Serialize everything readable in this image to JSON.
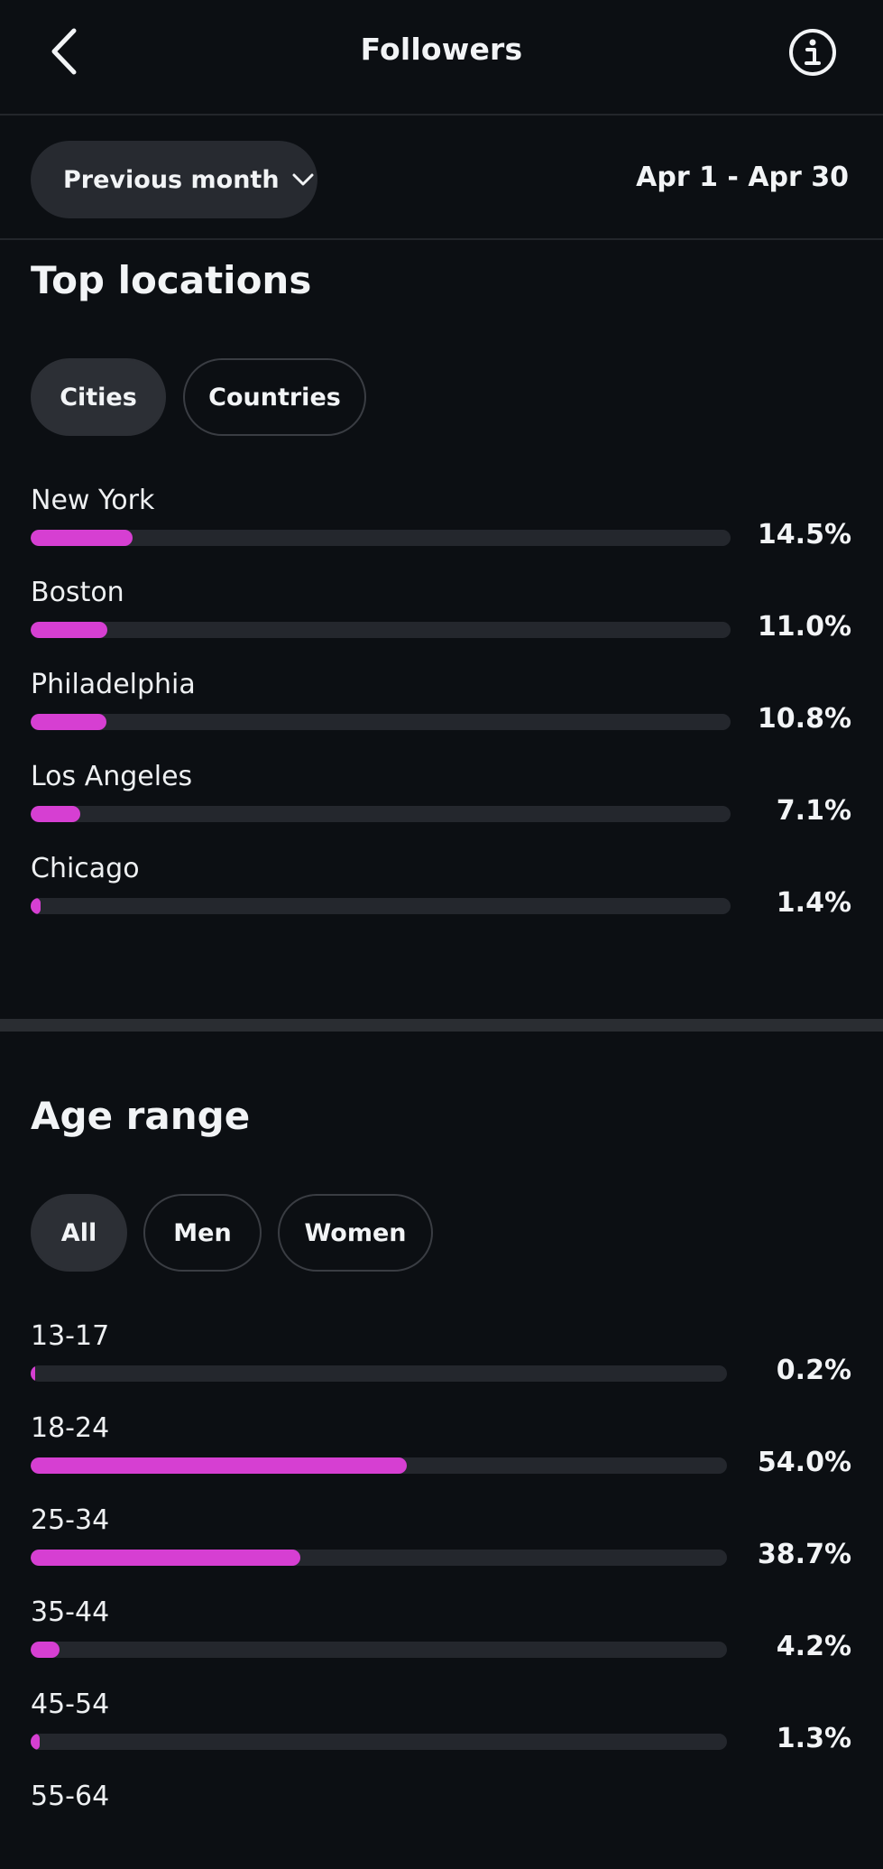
{
  "header": {
    "title": "Followers",
    "back_icon": "chevron-left-icon",
    "info_icon": "info-icon"
  },
  "filters": {
    "period": "Previous month",
    "date_range": "Apr 1 - Apr 30"
  },
  "top_locations": {
    "title": "Top locations",
    "tabs": [
      {
        "label": "Cities",
        "active": true
      },
      {
        "label": "Countries",
        "active": false
      }
    ],
    "items": [
      {
        "label": "New York",
        "value": "14.5%",
        "pct": 14.5
      },
      {
        "label": "Boston",
        "value": "11.0%",
        "pct": 11.0
      },
      {
        "label": "Philadelphia",
        "value": "10.8%",
        "pct": 10.8
      },
      {
        "label": "Los Angeles",
        "value": "7.1%",
        "pct": 7.1
      },
      {
        "label": "Chicago",
        "value": "1.4%",
        "pct": 1.4
      }
    ]
  },
  "age_range": {
    "title": "Age range",
    "tabs": [
      {
        "label": "All",
        "active": true
      },
      {
        "label": "Men",
        "active": false
      },
      {
        "label": "Women",
        "active": false
      }
    ],
    "items": [
      {
        "label": "13-17",
        "value": "0.2%",
        "pct": 0.2
      },
      {
        "label": "18-24",
        "value": "54.0%",
        "pct": 54.0
      },
      {
        "label": "25-34",
        "value": "38.7%",
        "pct": 38.7
      },
      {
        "label": "35-44",
        "value": "4.2%",
        "pct": 4.2
      },
      {
        "label": "45-54",
        "value": "1.3%",
        "pct": 1.3
      },
      {
        "label": "55-64",
        "value": "",
        "pct": null
      }
    ]
  },
  "colors": {
    "bar_fill": "#d63fd2",
    "bar_track": "#24272d",
    "background": "#0c0f13"
  }
}
